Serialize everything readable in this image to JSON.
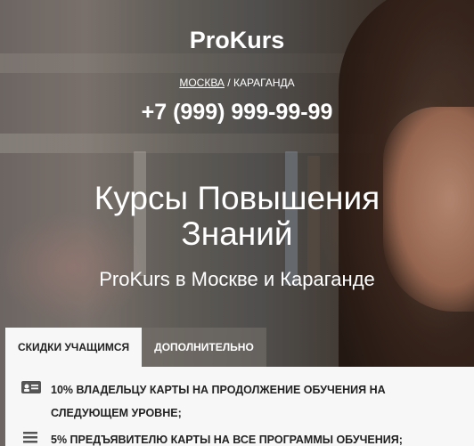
{
  "header": {
    "logo": "ProKurs",
    "city_active": "МОСКВА",
    "city_separator": "/",
    "city_other": "КАРАГАНДА",
    "phone": "+7 (999) 999-99-99"
  },
  "hero": {
    "title_line1": "Курсы Повышения",
    "title_line2": "Знаний",
    "subtitle": "ProKurs в Москве и Караганде"
  },
  "tabs": [
    {
      "label": "СКИДКИ УЧАЩИМСЯ",
      "active": true
    },
    {
      "label": "ДОПОЛНИТЕЛЬНО",
      "active": false
    }
  ],
  "discounts": [
    {
      "icon": "id-card-icon",
      "text_line1": "10% ВЛАДЕЛЬЦУ КАРТЫ НА ПРОДОЛЖЕНИЕ ОБУЧЕНИЯ НА",
      "text_line2": "СЛЕДУЮЩЕМ УРОВНЕ;"
    },
    {
      "icon": "list-icon",
      "text_line1": "5% ПРЕДЪЯВИТЕЛЮ КАРТЫ НА ВСЕ ПРОГРАММЫ ОБУЧЕНИЯ;"
    }
  ],
  "colors": {
    "panel_bg": "#f7f7f7",
    "text_dark": "#222222",
    "hero_text": "#ffffff"
  }
}
